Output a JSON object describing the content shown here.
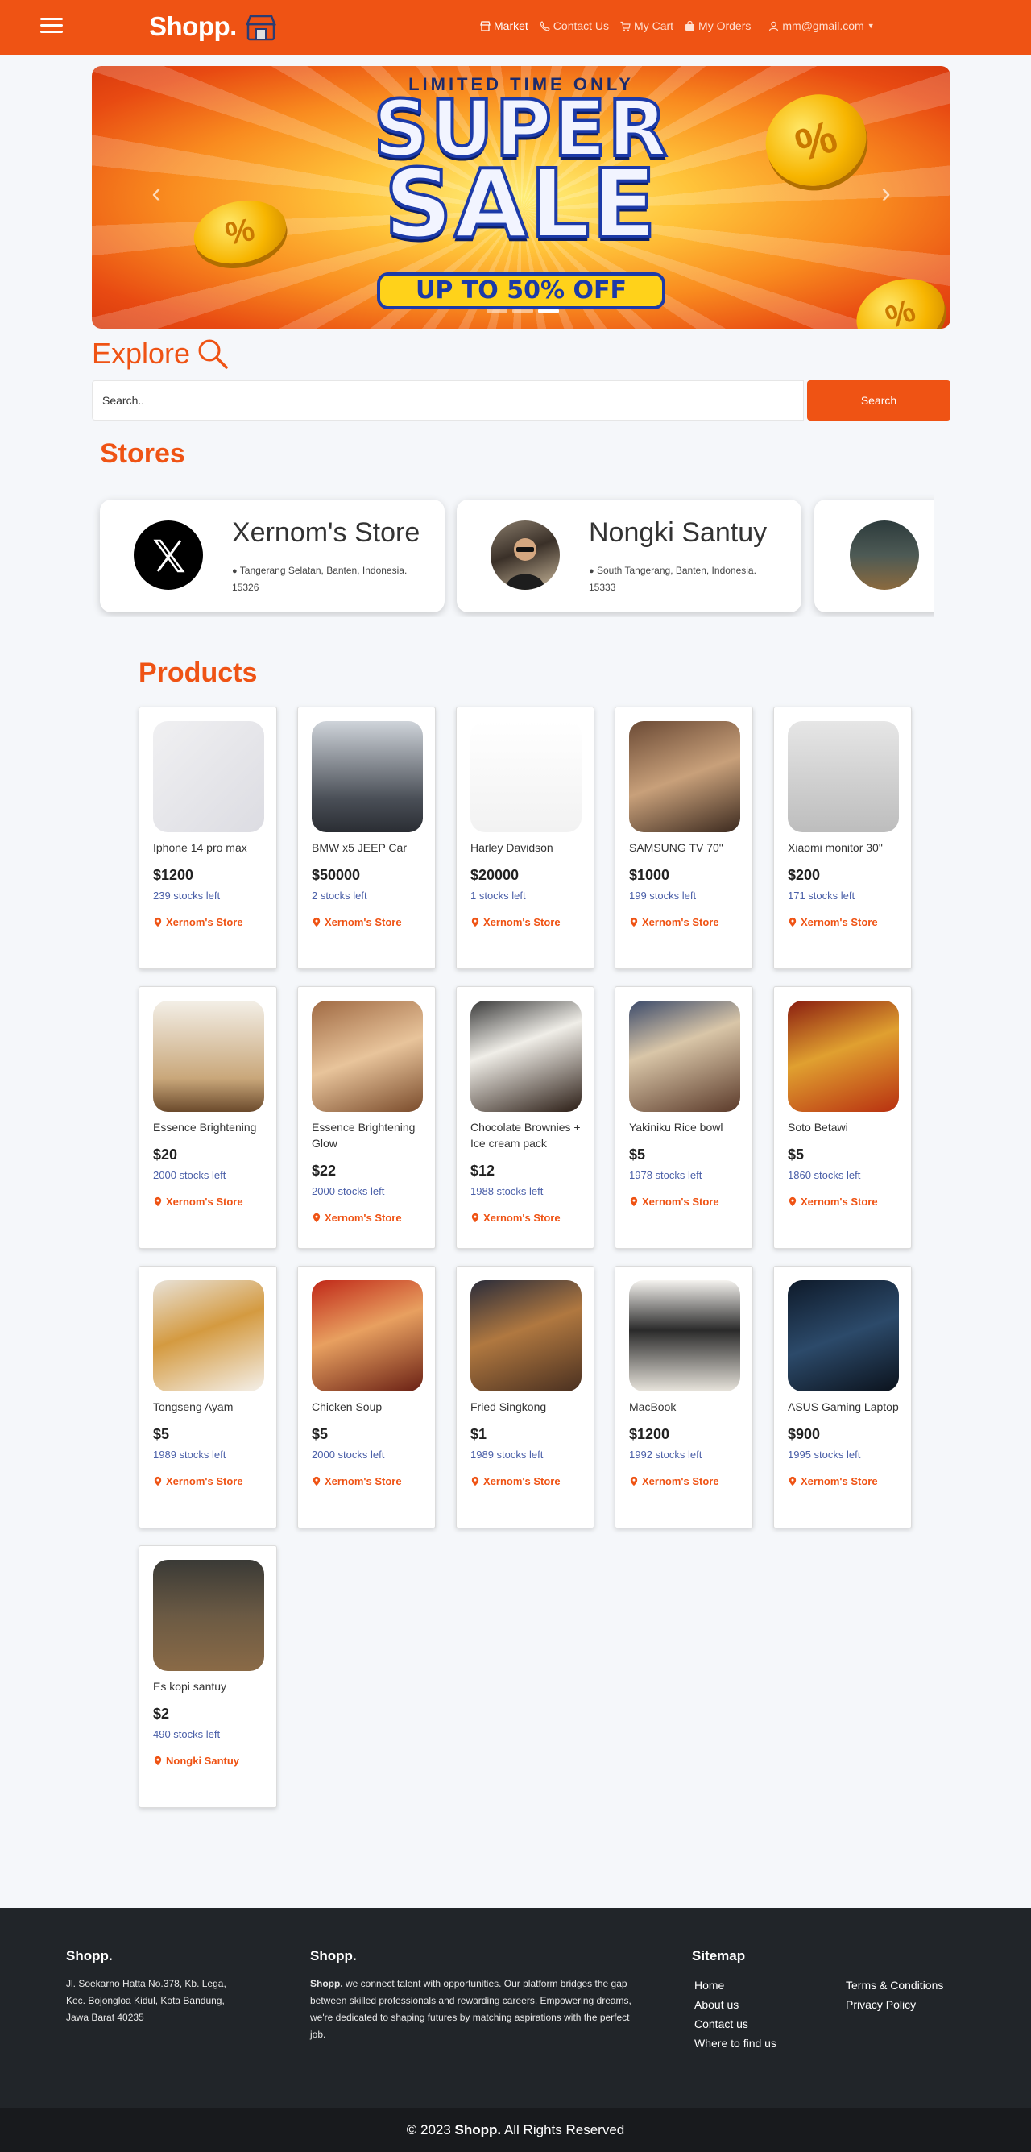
{
  "navbar": {
    "brand": "Shopp.",
    "links": [
      {
        "label": "Market",
        "icon": "store-icon",
        "active": true
      },
      {
        "label": "Contact Us",
        "icon": "phone-icon",
        "active": false
      },
      {
        "label": "My Cart",
        "icon": "cart-icon",
        "active": false
      },
      {
        "label": "My Orders",
        "icon": "bag-icon",
        "active": false
      },
      {
        "label": "mm@gmail.com",
        "icon": "user-icon",
        "active": false
      }
    ]
  },
  "banner": {
    "top_text": "LIMITED TIME ONLY",
    "line1": "SUPER",
    "line2": "SALE",
    "pill": "UP TO 50% OFF",
    "prev_label": "‹",
    "next_label": "›"
  },
  "explore": {
    "title": "Explore",
    "search_placeholder": "Search..",
    "search_button": "Search"
  },
  "stores": {
    "title": "Stores",
    "items": [
      {
        "name": "Xernom's Store",
        "address": "Tangerang Selatan, Banten, Indonesia. 15326"
      },
      {
        "name": "Nongki Santuy",
        "address": "South Tangerang, Banten, Indonesia. 15333"
      },
      {
        "name": "",
        "address": ""
      }
    ]
  },
  "products": {
    "title": "Products",
    "items": [
      {
        "name": "Iphone 14 pro max",
        "price": "$1200",
        "stock": "239 stocks left",
        "store": "Xernom's Store"
      },
      {
        "name": "BMW x5 JEEP Car",
        "price": "$50000",
        "stock": "2 stocks left",
        "store": "Xernom's Store"
      },
      {
        "name": "Harley Davidson",
        "price": "$20000",
        "stock": "1 stocks left",
        "store": "Xernom's Store"
      },
      {
        "name": "SAMSUNG TV 70\"",
        "price": "$1000",
        "stock": "199 stocks left",
        "store": "Xernom's Store"
      },
      {
        "name": "Xiaomi monitor 30\"",
        "price": "$200",
        "stock": "171 stocks left",
        "store": "Xernom's Store"
      },
      {
        "name": "Essence Brightening",
        "price": "$20",
        "stock": "2000 stocks left",
        "store": "Xernom's Store"
      },
      {
        "name": "Essence Brightening Glow",
        "price": "$22",
        "stock": "2000 stocks left",
        "store": "Xernom's Store"
      },
      {
        "name": "Chocolate Brownies + Ice cream pack",
        "price": "$12",
        "stock": "1988 stocks left",
        "store": "Xernom's Store"
      },
      {
        "name": "Yakiniku Rice bowl",
        "price": "$5",
        "stock": "1978 stocks left",
        "store": "Xernom's Store"
      },
      {
        "name": "Soto Betawi",
        "price": "$5",
        "stock": "1860 stocks left",
        "store": "Xernom's Store"
      },
      {
        "name": "Tongseng Ayam",
        "price": "$5",
        "stock": "1989 stocks left",
        "store": "Xernom's Store"
      },
      {
        "name": "Chicken Soup",
        "price": "$5",
        "stock": "2000 stocks left",
        "store": "Xernom's Store"
      },
      {
        "name": "Fried Singkong",
        "price": "$1",
        "stock": "1989 stocks left",
        "store": "Xernom's Store"
      },
      {
        "name": "MacBook",
        "price": "$1200",
        "stock": "1992 stocks left",
        "store": "Xernom's Store"
      },
      {
        "name": "ASUS Gaming Laptop",
        "price": "$900",
        "stock": "1995 stocks left",
        "store": "Xernom's Store"
      },
      {
        "name": "Es kopi santuy",
        "price": "$2",
        "stock": "490 stocks left",
        "store": "Nongki Santuy"
      }
    ]
  },
  "footer": {
    "col1_title": "Shopp.",
    "address": "Jl. Soekarno Hatta No.378, Kb. Lega, Kec. Bojongloa Kidul, Kota Bandung, Jawa Barat 40235",
    "col2_title": "Shopp.",
    "about_brand": "Shopp.",
    "about_text": " we connect talent with opportunities. Our platform bridges the gap between skilled professionals and rewarding careers. Empowering dreams, we're dedicated to shaping futures by matching aspirations with the perfect job.",
    "sitemap_title": "Sitemap",
    "sitemap_links": [
      "Home",
      "About us",
      "Contact us",
      "Where to find us",
      "Terms & Conditions",
      "Privacy Policy"
    ],
    "copyright_prefix": "© 2023 ",
    "copyright_brand": "Shopp.",
    "copyright_suffix": " All Rights Reserved"
  }
}
